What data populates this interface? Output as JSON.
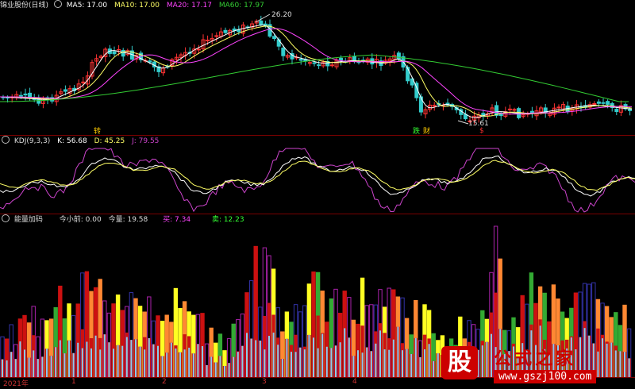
{
  "main_panel": {
    "title": "锦业股份(日线)",
    "ma": [
      {
        "label": "MA5: 17.00",
        "color": "#ffffff"
      },
      {
        "label": "MA10: 17.00",
        "color": "#ffff66"
      },
      {
        "label": "MA20: 17.17",
        "color": "#ff44ff"
      },
      {
        "label": "MA60: 17.97",
        "color": "#33cc33"
      }
    ],
    "high_label": "26.20",
    "low_label": "15.61",
    "marks": [
      "转",
      "跌",
      "财",
      "$"
    ]
  },
  "kdj_panel": {
    "title": "KDJ(9,3,3)",
    "k": "K: 56.68",
    "d": "D: 45.25",
    "j": "J: 79.55",
    "colors": {
      "k": "#ffffff",
      "d": "#ffff66",
      "j": "#cc44cc"
    }
  },
  "vol_panel": {
    "title": "能量加码",
    "v1": "今小前: 0.00",
    "v2": "今量: 19.58",
    "buy": "买: 7.34",
    "sell": "卖: 12.23",
    "colors": {
      "buy": "#ff44ff",
      "sell": "#33ff33"
    }
  },
  "x_axis": [
    "2021年",
    "1",
    "2",
    "3",
    "4"
  ],
  "watermark": {
    "logo": "股",
    "title": "公式之家",
    "url": "www.gszj100.com"
  },
  "colors": {
    "up": "#ff3333",
    "down": "#33cccc",
    "border": "#7a0000"
  }
}
